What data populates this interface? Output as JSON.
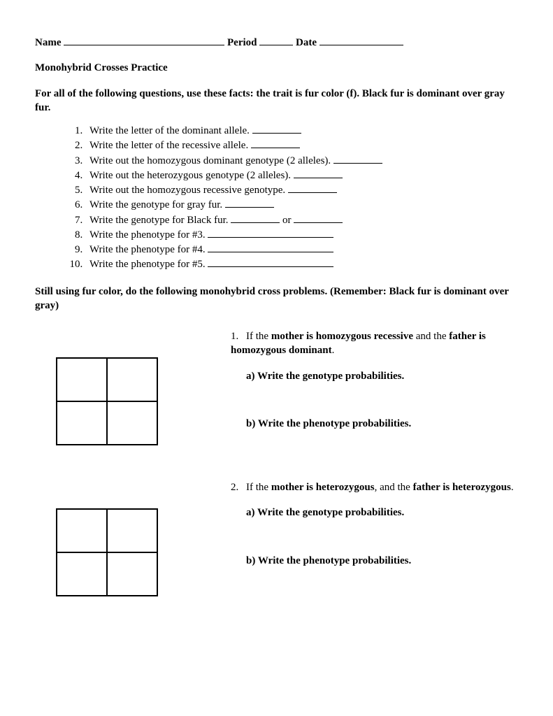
{
  "header": {
    "name_label": "Name",
    "period_label": "Period",
    "date_label": "Date"
  },
  "title": "Monohybrid Crosses Practice",
  "instructions": "For all of the following questions, use these facts: the trait is fur color (f). Black fur is dominant over gray fur.",
  "questions": [
    "Write the letter of the dominant allele.",
    "Write the letter of the recessive allele.",
    "Write out the homozygous dominant genotype (2 alleles).",
    "Write out the heterozygous genotype (2 alleles).",
    "Write out the homozygous recessive genotype.",
    "Write the genotype for gray fur.",
    "Write the genotype for Black fur.",
    "Write the phenotype for #3.",
    "Write the phenotype for #4.",
    "Write the phenotype for #5."
  ],
  "q7_or": "or",
  "section_heading": "Still using fur color, do the following monohybrid cross problems. (Remember: Black fur is dominant over gray)",
  "problems": [
    {
      "num": "1.",
      "prefix": "If the ",
      "bold1": "mother is homozygous recessive",
      "mid": " and the ",
      "bold2": "father is homozygous dominant",
      "suffix": ".",
      "sub_a": "a) Write the genotype probabilities.",
      "sub_b": "b) Write the phenotype probabilities."
    },
    {
      "num": "2.",
      "prefix": "If the ",
      "bold1": "mother is heterozygous",
      "mid": ", and the ",
      "bold2": "father is heterozygous",
      "suffix": ".",
      "sub_a": "a) Write the genotype probabilities.",
      "sub_b": "b) Write the phenotype probabilities."
    }
  ]
}
